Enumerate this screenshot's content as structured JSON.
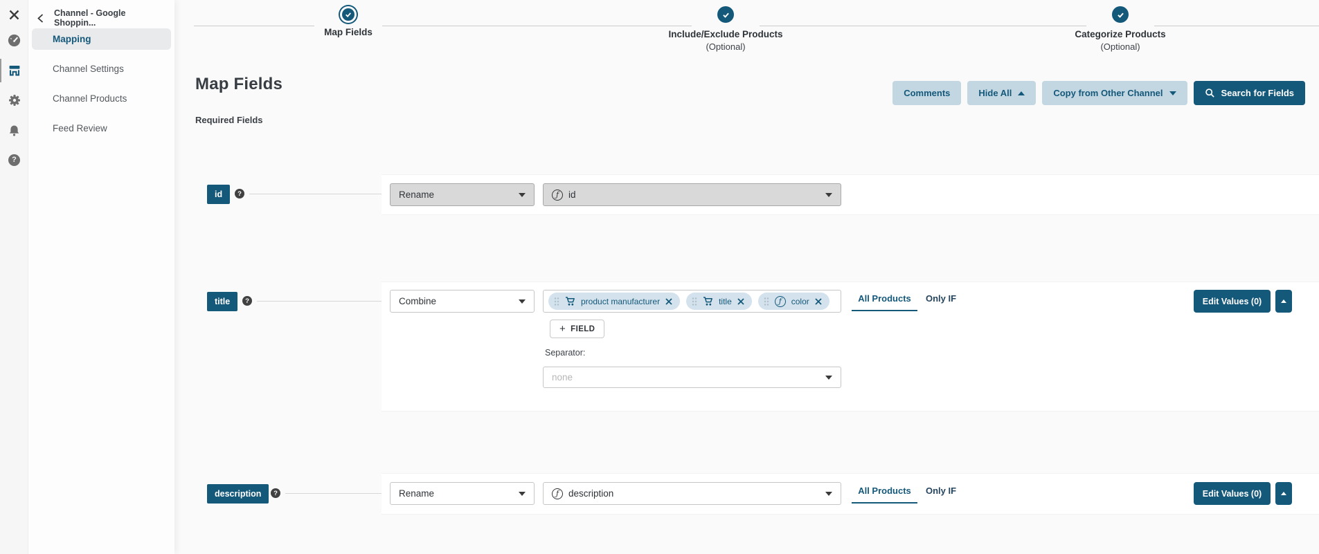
{
  "colors": {
    "accent": "#14587a",
    "light_button_bg": "#c3d7e2",
    "chip_bg": "#d3e2ec",
    "active_item_bg": "#e9eaec"
  },
  "rail": {
    "icons": [
      "close-icon",
      "dashboard-icon",
      "store-icon",
      "settings-icon",
      "notifications-icon",
      "help-icon"
    ]
  },
  "sidebar": {
    "title": "Channel - Google Shoppin...",
    "items": [
      {
        "label": "Mapping",
        "active": true
      },
      {
        "label": "Channel Settings",
        "active": false
      },
      {
        "label": "Channel Products",
        "active": false
      },
      {
        "label": "Feed Review",
        "active": false
      }
    ]
  },
  "stepper": {
    "steps": [
      {
        "label": "Map Fields",
        "sub": ""
      },
      {
        "label": "Include/Exclude Products",
        "sub": "(Optional)"
      },
      {
        "label": "Categorize Products",
        "sub": "(Optional)"
      }
    ]
  },
  "page": {
    "title": "Map Fields",
    "section": "Required Fields"
  },
  "toolbar": {
    "comments": "Comments",
    "hide_all": "Hide All",
    "copy_from_other_channel": "Copy from Other Channel",
    "search_for_fields": "Search for Fields"
  },
  "tabs": {
    "all_products": "All Products",
    "only_if": "Only IF"
  },
  "rows": [
    {
      "field": "id",
      "action": "Rename",
      "value": "id"
    },
    {
      "field": "title",
      "action": "Combine",
      "chips": [
        {
          "icon": "cart-icon",
          "label": "product manufacturer"
        },
        {
          "icon": "cart-icon",
          "label": "title"
        },
        {
          "icon": "function-icon",
          "label": "color"
        }
      ],
      "add_field_label": "FIELD",
      "add_field_plus": "+",
      "separator_label": "Separator:",
      "separator_placeholder": "none",
      "edit_values": "Edit Values (0)"
    },
    {
      "field": "description",
      "action": "Rename",
      "value": "description",
      "edit_values": "Edit Values (0)"
    }
  ]
}
